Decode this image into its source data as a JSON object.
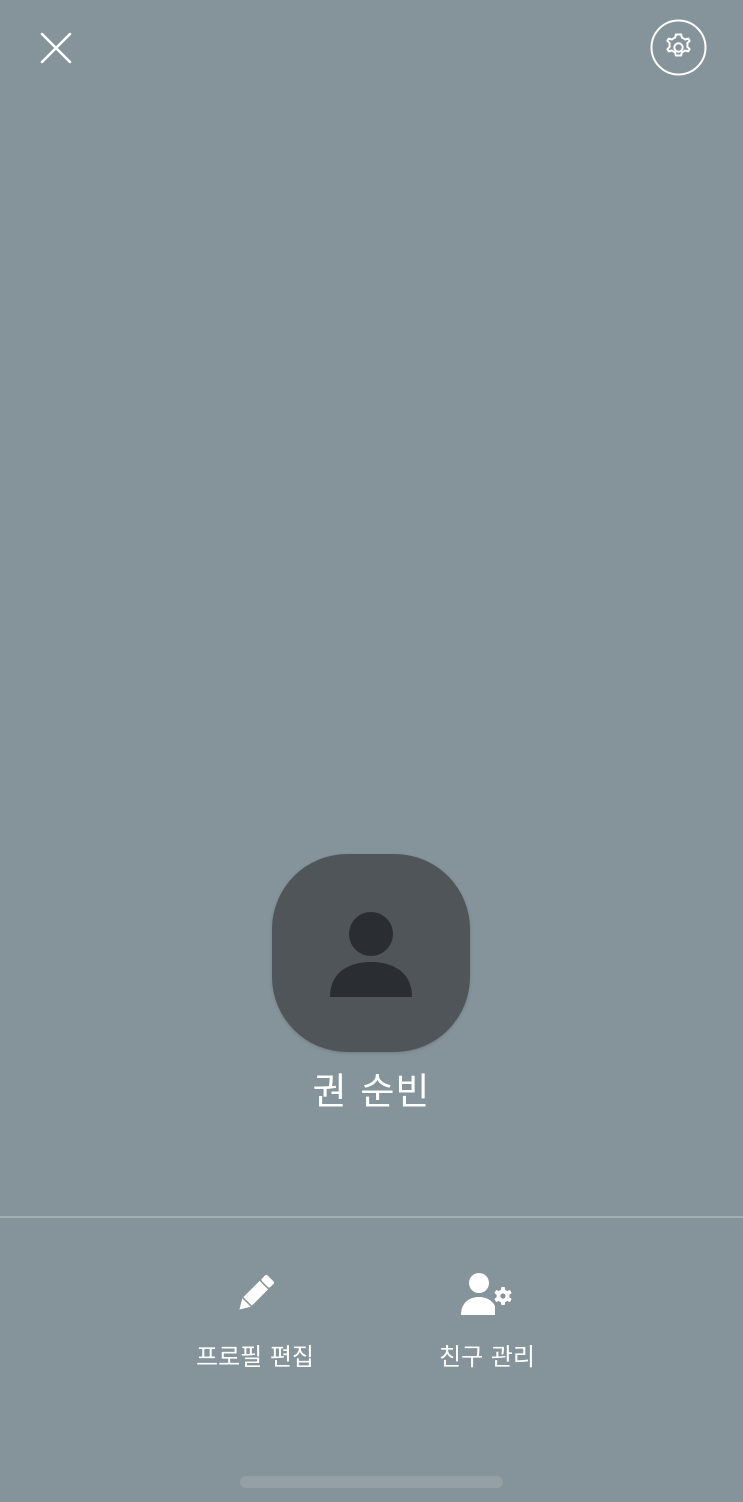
{
  "profile": {
    "name": "권 순빈"
  },
  "actions": [
    {
      "label": "프로필 편집",
      "icon": "pencil-icon"
    },
    {
      "label": "친구 관리",
      "icon": "person-gear-icon"
    }
  ],
  "header": {
    "close_icon": "close-icon",
    "settings_icon": "gear-icon"
  },
  "colors": {
    "background": "#85939a",
    "avatar_bg": "#50555a",
    "avatar_glyph": "#2a2e32",
    "text": "#ffffff"
  }
}
